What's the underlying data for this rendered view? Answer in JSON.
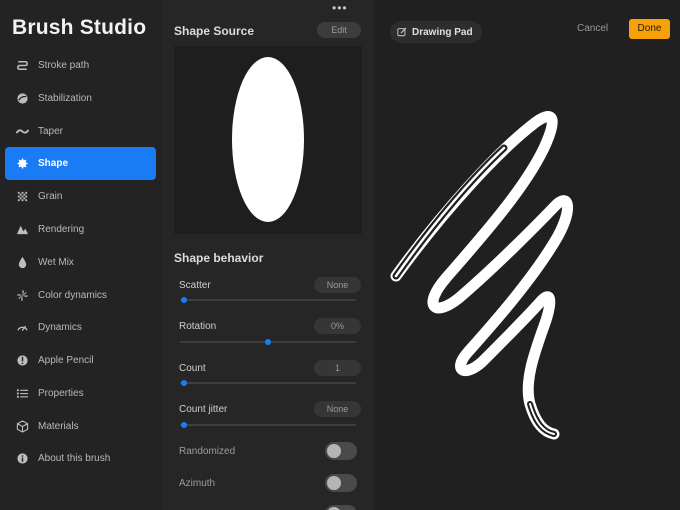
{
  "app": {
    "title": "Brush Studio"
  },
  "sidebar": {
    "items": [
      {
        "label": "Stroke path",
        "icon": "stroke-path-icon"
      },
      {
        "label": "Stabilization",
        "icon": "stabilization-icon"
      },
      {
        "label": "Taper",
        "icon": "taper-icon"
      },
      {
        "label": "Shape",
        "icon": "shape-icon",
        "active": true
      },
      {
        "label": "Grain",
        "icon": "grain-icon"
      },
      {
        "label": "Rendering",
        "icon": "rendering-icon"
      },
      {
        "label": "Wet Mix",
        "icon": "wet-mix-icon"
      },
      {
        "label": "Color dynamics",
        "icon": "color-dynamics-icon"
      },
      {
        "label": "Dynamics",
        "icon": "dynamics-icon"
      },
      {
        "label": "Apple Pencil",
        "icon": "apple-pencil-icon"
      },
      {
        "label": "Properties",
        "icon": "properties-icon"
      },
      {
        "label": "Materials",
        "icon": "materials-icon"
      },
      {
        "label": "About this brush",
        "icon": "info-icon"
      }
    ]
  },
  "panel": {
    "shape_source": {
      "title": "Shape Source",
      "edit_label": "Edit"
    },
    "behavior": {
      "title": "Shape behavior",
      "sliders": [
        {
          "label": "Scatter",
          "value": "None",
          "fraction": 0.0
        },
        {
          "label": "Rotation",
          "value": "0%",
          "fraction": 0.5
        },
        {
          "label": "Count",
          "value": "1",
          "fraction": 0.0
        },
        {
          "label": "Count jitter",
          "value": "None",
          "fraction": 0.0
        }
      ],
      "toggles": [
        {
          "label": "Randomized",
          "on": false
        },
        {
          "label": "Azimuth",
          "on": false
        }
      ]
    }
  },
  "pad": {
    "title": "Drawing Pad",
    "cancel_label": "Cancel",
    "done_label": "Done"
  },
  "colors": {
    "accent": "#1a7cf5",
    "done": "#f6a00a"
  }
}
